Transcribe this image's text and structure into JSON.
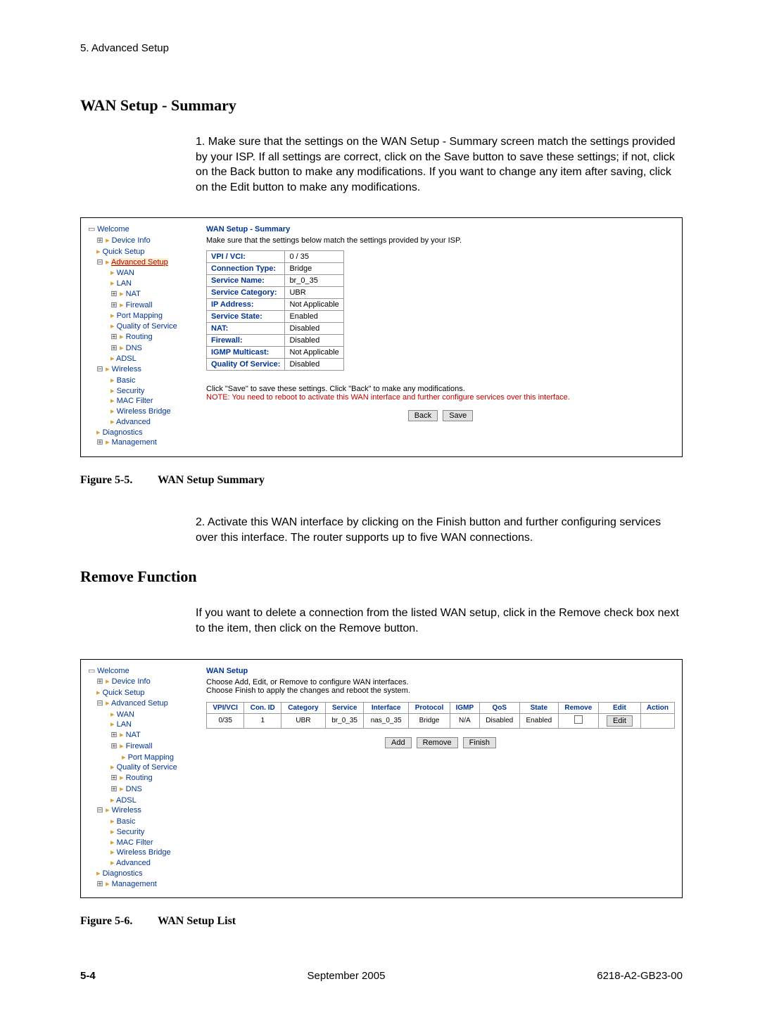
{
  "header": {
    "chapter": "5. Advanced Setup"
  },
  "section1": {
    "title": "WAN Setup - Summary",
    "para1": "1. Make sure that the settings on the WAN Setup - Summary screen match the settings provided by your ISP. If all settings are correct, click on the Save button to save these settings; if not, click on the Back button to make any modifications. If you want to change any item after saving, click on the Edit button to make any modifications."
  },
  "tree": {
    "welcome": "Welcome",
    "device_info": "Device Info",
    "quick_setup": "Quick Setup",
    "advanced_setup": "Advanced Setup",
    "wan": "WAN",
    "lan": "LAN",
    "nat": "NAT",
    "firewall": "Firewall",
    "port_mapping": "Port Mapping",
    "qos": "Quality of Service",
    "routing": "Routing",
    "dns": "DNS",
    "adsl": "ADSL",
    "wireless": "Wireless",
    "basic": "Basic",
    "security": "Security",
    "mac_filter": "MAC Filter",
    "wireless_bridge": "Wireless Bridge",
    "advanced": "Advanced",
    "diagnostics": "Diagnostics",
    "management": "Management"
  },
  "fig5": {
    "title": "WAN Setup - Summary",
    "subtitle": "Make sure that the settings below match the settings provided by your ISP.",
    "rows": {
      "r1k": "VPI / VCI:",
      "r1v": "0 / 35",
      "r2k": "Connection Type:",
      "r2v": "Bridge",
      "r3k": "Service Name:",
      "r3v": "br_0_35",
      "r4k": "Service Category:",
      "r4v": "UBR",
      "r5k": "IP Address:",
      "r5v": "Not Applicable",
      "r6k": "Service State:",
      "r6v": "Enabled",
      "r7k": "NAT:",
      "r7v": "Disabled",
      "r8k": "Firewall:",
      "r8v": "Disabled",
      "r9k": "IGMP Multicast:",
      "r9v": "Not Applicable",
      "r10k": "Quality Of Service:",
      "r10v": "Disabled"
    },
    "note1": "Click \"Save\" to save these settings. Click \"Back\" to make any modifications.",
    "note2": "NOTE: You need to reboot to activate this WAN interface and further configure services over this interface.",
    "back": "Back",
    "save": "Save",
    "caption_num": "Figure 5-5.",
    "caption_text": "WAN Setup Summary"
  },
  "para2": "2. Activate this WAN interface by clicking on the Finish button and further configuring services over this interface. The router supports up to five WAN connections.",
  "section2": {
    "title": "Remove Function",
    "para": "If you want to delete a connection from the listed WAN setup, click in the Remove check box next to the item, then click on the Remove button."
  },
  "fig6": {
    "title": "WAN Setup",
    "sub1": "Choose Add, Edit, or Remove to configure WAN interfaces.",
    "sub2": "Choose Finish to apply the changes and reboot the system.",
    "headers": {
      "h1": "VPI/VCI",
      "h2": "Con. ID",
      "h3": "Category",
      "h4": "Service",
      "h5": "Interface",
      "h6": "Protocol",
      "h7": "IGMP",
      "h8": "QoS",
      "h9": "State",
      "h10": "Remove",
      "h11": "Edit",
      "h12": "Action"
    },
    "row": {
      "c1": "0/35",
      "c2": "1",
      "c3": "UBR",
      "c4": "br_0_35",
      "c5": "nas_0_35",
      "c6": "Bridge",
      "c7": "N/A",
      "c8": "Disabled",
      "c9": "Enabled",
      "c11": "Edit"
    },
    "add": "Add",
    "remove": "Remove",
    "finish": "Finish",
    "caption_num": "Figure 5-6.",
    "caption_text": "WAN Setup List"
  },
  "footer": {
    "page": "5-4",
    "date": "September 2005",
    "doc": "6218-A2-GB23-00"
  }
}
